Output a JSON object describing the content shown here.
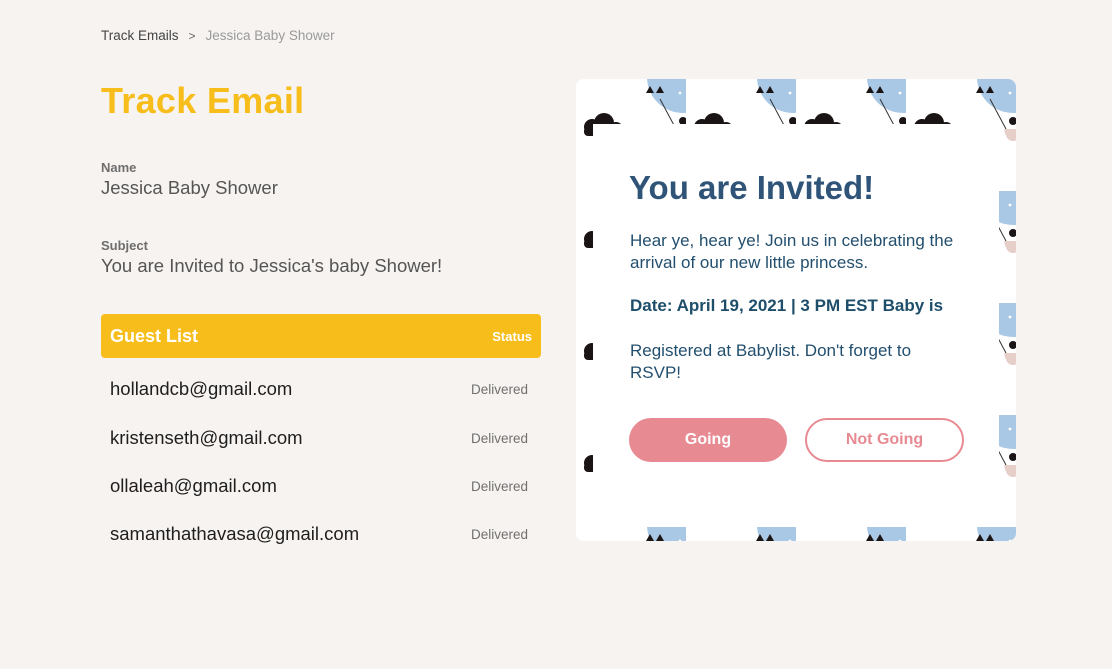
{
  "breadcrumb": {
    "parent": "Track Emails",
    "separator": ">",
    "current": "Jessica Baby Shower"
  },
  "page": {
    "title": "Track Email",
    "name_label": "Name",
    "name_value": "Jessica Baby Shower",
    "subject_label": "Subject",
    "subject_value": "You are Invited to Jessica's baby Shower!"
  },
  "guest_list": {
    "title": "Guest List",
    "status_header": "Status",
    "rows": [
      {
        "email": "hollandcb@gmail.com",
        "status": "Delivered"
      },
      {
        "email": "kristenseth@gmail.com",
        "status": "Delivered"
      },
      {
        "email": "ollaleah@gmail.com",
        "status": "Delivered"
      },
      {
        "email": "samanthathavasa@gmail.com",
        "status": "Delivered"
      }
    ]
  },
  "preview": {
    "heading": "You are Invited!",
    "body": "Hear ye, hear ye! Join us in celebrating the arrival of our new little princess.",
    "date_line": "Date: April 19, 2021 | 3 PM EST Baby is",
    "registry": "Registered at Babylist. Don't forget to RSVP!",
    "going_label": "Going",
    "not_going_label": "Not Going",
    "pattern_icons": [
      "hot-air-balloon-icon",
      "rainbow-icon",
      "cloud-icon"
    ]
  },
  "colors": {
    "accent": "#f7bd1a",
    "background": "#f7f3f0",
    "invite_heading": "#2f5478",
    "button_pink": "#e88a92",
    "balloon_blue": "#a9c8e6",
    "rainbow_pink": "#f2b6bb"
  }
}
